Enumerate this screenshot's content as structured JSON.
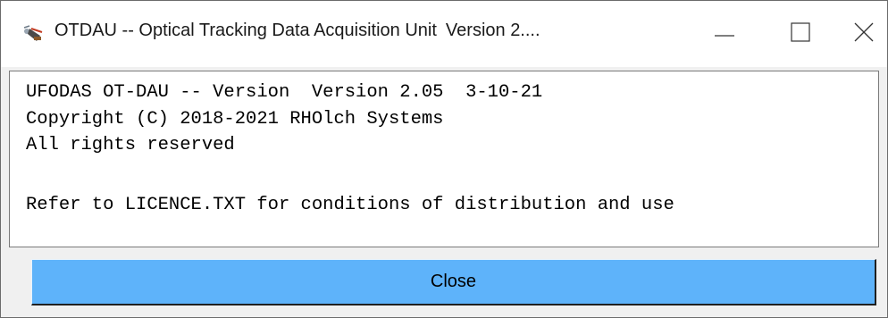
{
  "window": {
    "title": "OTDAU -- Optical Tracking Data Acquisition Unit",
    "version_fragment": "Version 2....",
    "icon": "satellite-dish-icon",
    "controls": {
      "minimize_icon": "minimize-icon",
      "maximize_icon": "maximize-icon",
      "close_icon": "close-icon"
    }
  },
  "about_text": {
    "lines": [
      "UFODAS OT-DAU -- Version  Version 2.05  3-10-21",
      "Copyright (C) 2018-2021 RHOlch Systems",
      "All rights reserved",
      "",
      "Refer to LICENCE.TXT for conditions of distribution and use"
    ]
  },
  "buttons": {
    "close_label": "Close"
  },
  "colors": {
    "button_fill": "#5eb3fa",
    "window_bg": "#f0f0f0",
    "text": "#000000"
  }
}
